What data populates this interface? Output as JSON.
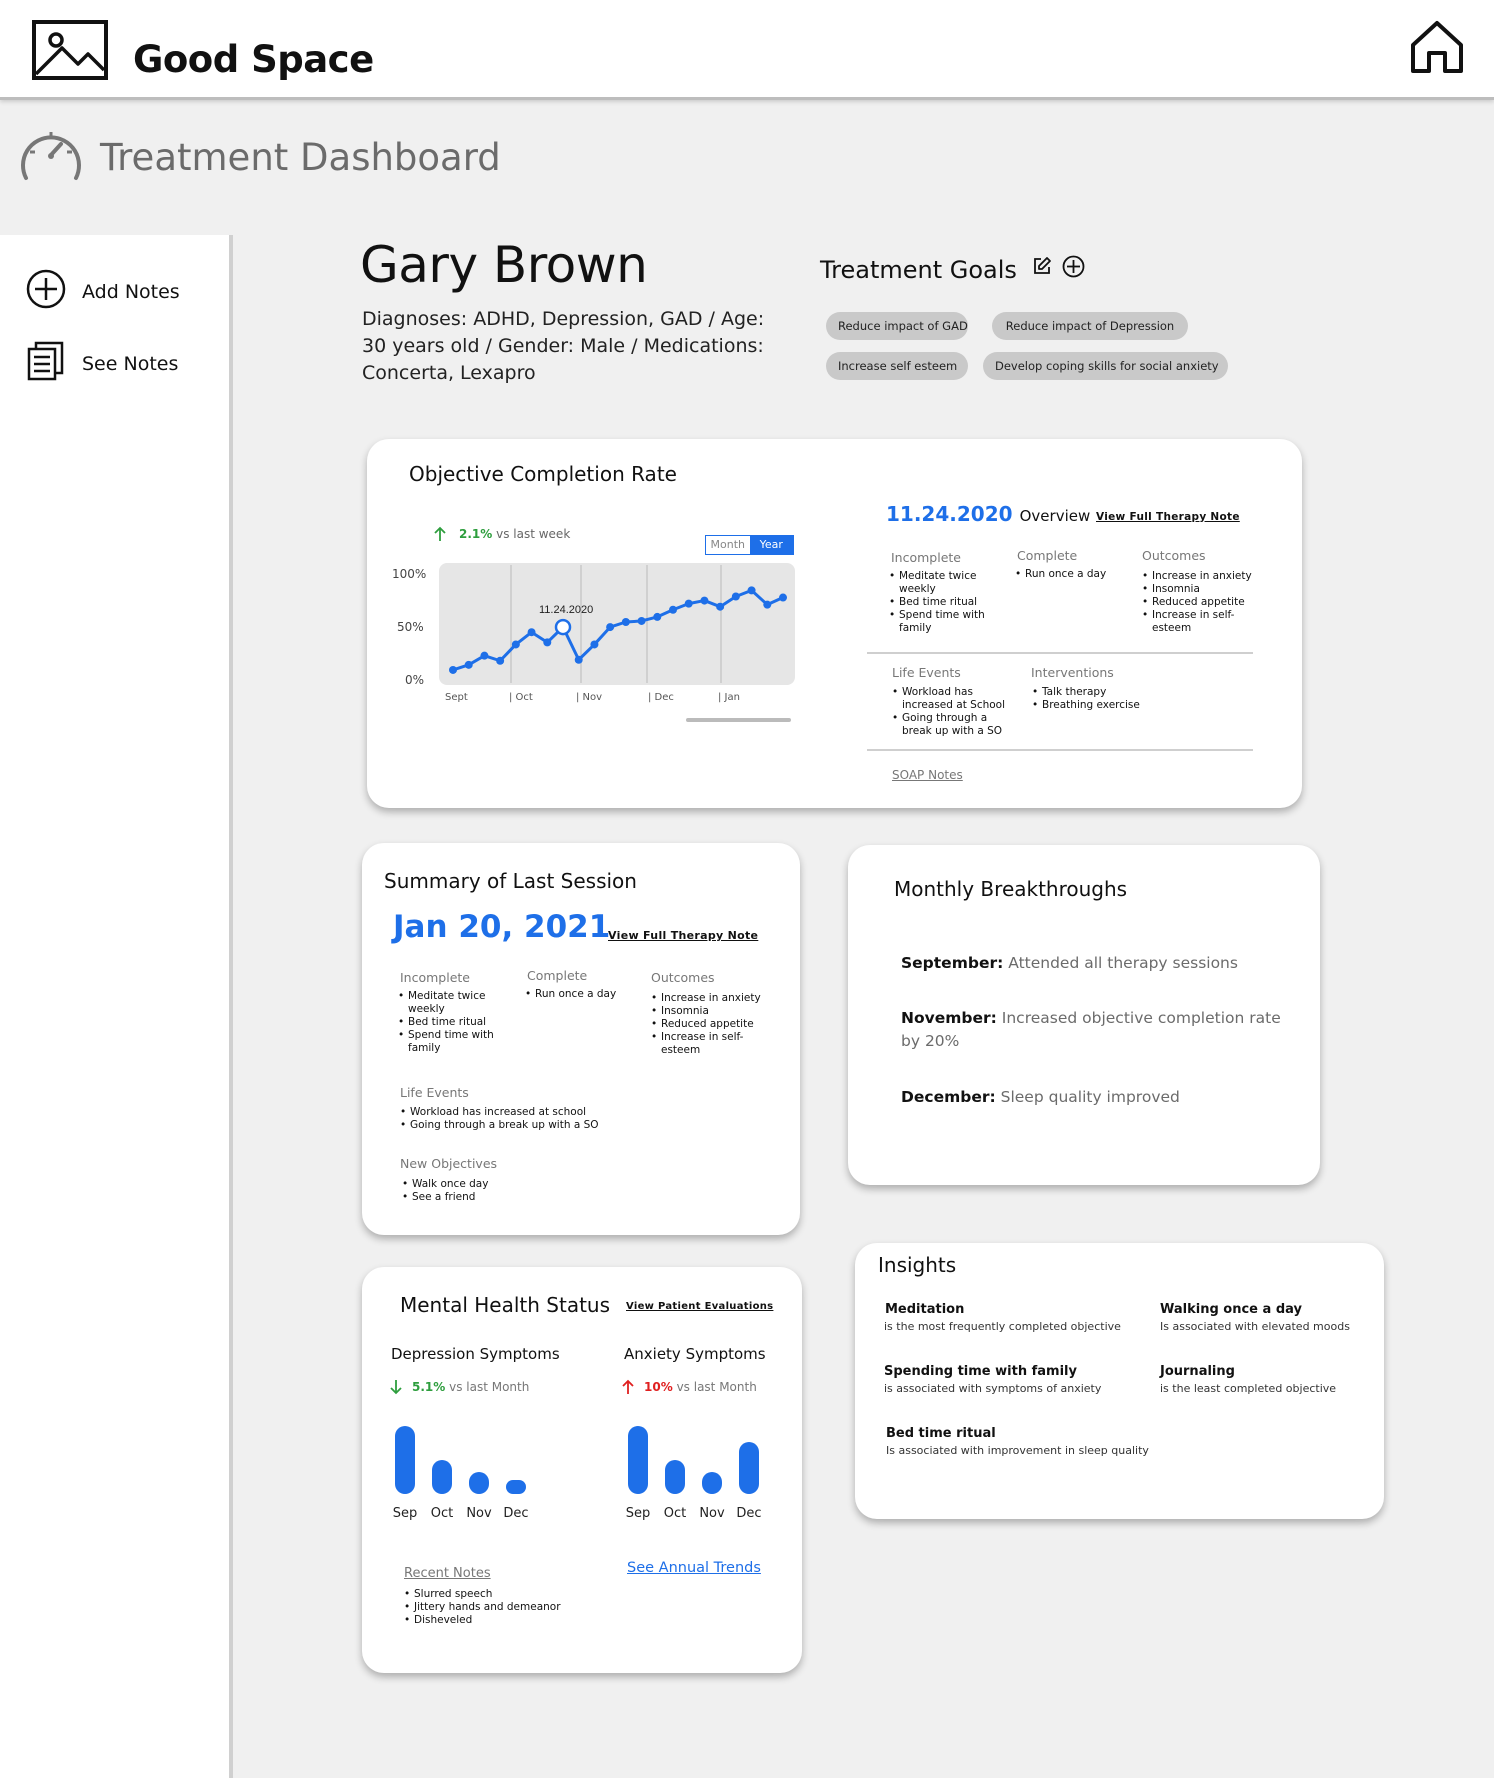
{
  "app": {
    "name": "Good Space"
  },
  "icons": {
    "logo": "image-icon",
    "home": "home-icon",
    "dashboard": "gauge-icon",
    "add": "plus-circle-icon",
    "notes": "notes-icon",
    "edit": "edit-icon"
  },
  "page": {
    "title": "Treatment Dashboard"
  },
  "sidebar": {
    "items": [
      {
        "label": "Add Notes",
        "icon": "plus-circle-icon"
      },
      {
        "label": "See Notes",
        "icon": "notes-icon"
      }
    ]
  },
  "patient": {
    "name": "Gary Brown",
    "info": "Diagnoses: ADHD, Depression, GAD / Age: 30 years old / Gender: Male /  Medications: Concerta, Lexapro"
  },
  "goals": {
    "title": "Treatment Goals",
    "chips": [
      "Reduce impact of GAD",
      "Reduce impact of Depression",
      "Increase self esteem",
      "Develop coping skills for social anxiety"
    ]
  },
  "completion": {
    "title": "Objective Completion Rate",
    "delta": "2.1%",
    "delta_text": "vs last week",
    "toggle": {
      "month": "Month",
      "year": "Year",
      "selected": "Year"
    },
    "point_label": "11.24.2020",
    "overview": {
      "date": "11.24.2020",
      "label": "Overview",
      "link": "View Full Therapy Note",
      "incomplete_label": "Incomplete",
      "incomplete": [
        "Meditate twice weekly",
        "Bed time ritual",
        "Spend time with family"
      ],
      "complete_label": "Complete",
      "complete": [
        "Run once a day"
      ],
      "outcomes_label": "Outcomes",
      "outcomes": [
        "Increase in anxiety",
        "Insomnia",
        "Reduced appetite",
        "Increase in self-esteem"
      ],
      "life_label": "Life Events",
      "life": [
        "Workload has increased at School",
        "Going through a break up with a SO"
      ],
      "interventions_label": "Interventions",
      "interventions": [
        "Talk therapy",
        "Breathing exercise"
      ],
      "soap": "SOAP Notes"
    }
  },
  "chart_data": {
    "type": "line",
    "ylabels": [
      "100%",
      "50%",
      "0%"
    ],
    "xlabels": [
      "Sept",
      "| Oct",
      "| Nov",
      "| Dec",
      "| Jan"
    ],
    "ylim": [
      0,
      100
    ],
    "values": [
      3,
      8,
      17,
      12,
      28,
      40,
      30,
      45,
      13,
      28,
      45,
      50,
      51,
      55,
      62,
      68,
      71,
      65,
      75,
      81,
      67,
      74
    ],
    "highlight_index": 7,
    "highlight_label": "11.24.2020"
  },
  "last_session": {
    "title": "Summary of Last Session",
    "date": "Jan 20, 2021",
    "link": "View Full Therapy Note",
    "incomplete_label": "Incomplete",
    "incomplete": [
      "Meditate twice weekly",
      "Bed time ritual",
      "Spend time with family"
    ],
    "complete_label": "Complete",
    "complete": [
      "Run once a day"
    ],
    "outcomes_label": "Outcomes",
    "outcomes": [
      "Increase in anxiety",
      "Insomnia",
      "Reduced appetite",
      "Increase in self-esteem"
    ],
    "life_label": "Life Events",
    "life": [
      "Workload has increased at school",
      "Going through a break up with a SO"
    ],
    "objectives_label": "New Objectives",
    "objectives": [
      "Walk once day",
      "See a friend"
    ]
  },
  "breakthroughs": {
    "title": "Monthly Breakthroughs",
    "items": [
      {
        "month": "September:",
        "text": "Attended all therapy sessions"
      },
      {
        "month": "November:",
        "text": "Increased objective completion rate by 20%"
      },
      {
        "month": "December:",
        "text": "Sleep quality improved"
      }
    ]
  },
  "mental_health": {
    "title": "Mental Health Status",
    "link": "View Patient Evaluations",
    "depression": {
      "label": "Depression Symptoms",
      "delta": "5.1%",
      "delta_text": "vs last Month",
      "direction": "down",
      "color": "#2e9e3e",
      "months": [
        "Sep",
        "Oct",
        "Nov",
        "Dec"
      ],
      "values": [
        68,
        34,
        22,
        14
      ]
    },
    "anxiety": {
      "label": "Anxiety Symptoms",
      "delta": "10%",
      "delta_text": "vs last Month",
      "direction": "up",
      "color": "#e02020",
      "months": [
        "Sep",
        "Oct",
        "Nov",
        "Dec"
      ],
      "values": [
        68,
        34,
        22,
        52
      ]
    },
    "annual_link": "See Annual Trends",
    "notes_label": "Recent Notes",
    "notes": [
      "Slurred speech",
      "Jittery hands and demeanor",
      "Disheveled"
    ]
  },
  "insights": {
    "title": "Insights",
    "items": [
      {
        "title": "Meditation",
        "sub": "is the most frequently completed objective"
      },
      {
        "title": "Walking once a day",
        "sub": "Is associated with elevated moods"
      },
      {
        "title": "Spending time with family",
        "sub": "is associated with symptoms of anxiety"
      },
      {
        "title": "Journaling",
        "sub": "is the least completed objective"
      },
      {
        "title": "Bed time ritual",
        "sub": "Is associated with improvement in sleep quality"
      }
    ]
  },
  "colors": {
    "accent": "#1e6fe8",
    "up": "#e02020",
    "down": "#2e9e3e",
    "chip": "#c9c9c9"
  }
}
